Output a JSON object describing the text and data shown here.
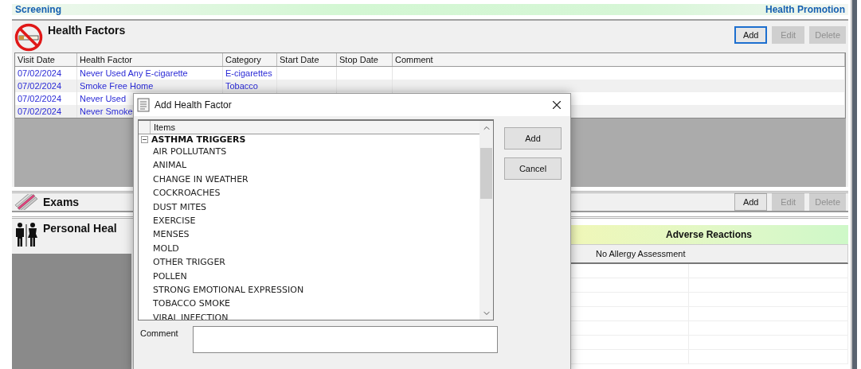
{
  "header": {
    "left": "Screening",
    "right": "Health Promotion"
  },
  "health_factors": {
    "title": "Health Factors",
    "buttons": [
      {
        "label": "Add",
        "disabled": false,
        "focused": true
      },
      {
        "label": "Edit",
        "disabled": true,
        "focused": false
      },
      {
        "label": "Delete",
        "disabled": true,
        "focused": false
      }
    ],
    "columns": [
      "Visit Date",
      "Health Factor",
      "Category",
      "Start Date",
      "Stop Date",
      "Comment"
    ],
    "rows": [
      {
        "visit_date": "07/02/2024",
        "health_factor": "Never Used Any E-cigarette",
        "category": "E-cigarettes"
      },
      {
        "visit_date": "07/02/2024",
        "health_factor": "Smoke Free Home",
        "category": "Tobacco"
      },
      {
        "visit_date": "07/02/2024",
        "health_factor": "Never Used",
        "category": ""
      },
      {
        "visit_date": "07/02/2024",
        "health_factor": "Never Smoke",
        "category": ""
      }
    ]
  },
  "exams": {
    "title": "Exams",
    "buttons": [
      {
        "label": "Add",
        "disabled": false,
        "focused": false
      },
      {
        "label": "Edit",
        "disabled": true,
        "focused": false
      },
      {
        "label": "Delete",
        "disabled": true,
        "focused": false
      }
    ]
  },
  "personal_health": {
    "title": "Personal Heal"
  },
  "adverse_reactions": {
    "title": "Adverse Reactions",
    "column": "No Allergy Assessment"
  },
  "dialog": {
    "title": "Add Health Factor",
    "list_header": "Items",
    "group": {
      "label": "ASTHMA TRIGGERS",
      "expanded": true,
      "children": [
        "AIR POLLUTANTS",
        "ANIMAL",
        "CHANGE IN WEATHER",
        "COCKROACHES",
        "DUST MITES",
        "EXERCISE",
        "MENSES",
        "MOLD",
        "OTHER TRIGGER",
        "POLLEN",
        "STRONG EMOTIONAL EXPRESSION",
        "TOBACCO SMOKE",
        "VIRAL INFECTION"
      ]
    },
    "buttons": [
      "Add",
      "Cancel"
    ],
    "comment_label": "Comment"
  }
}
